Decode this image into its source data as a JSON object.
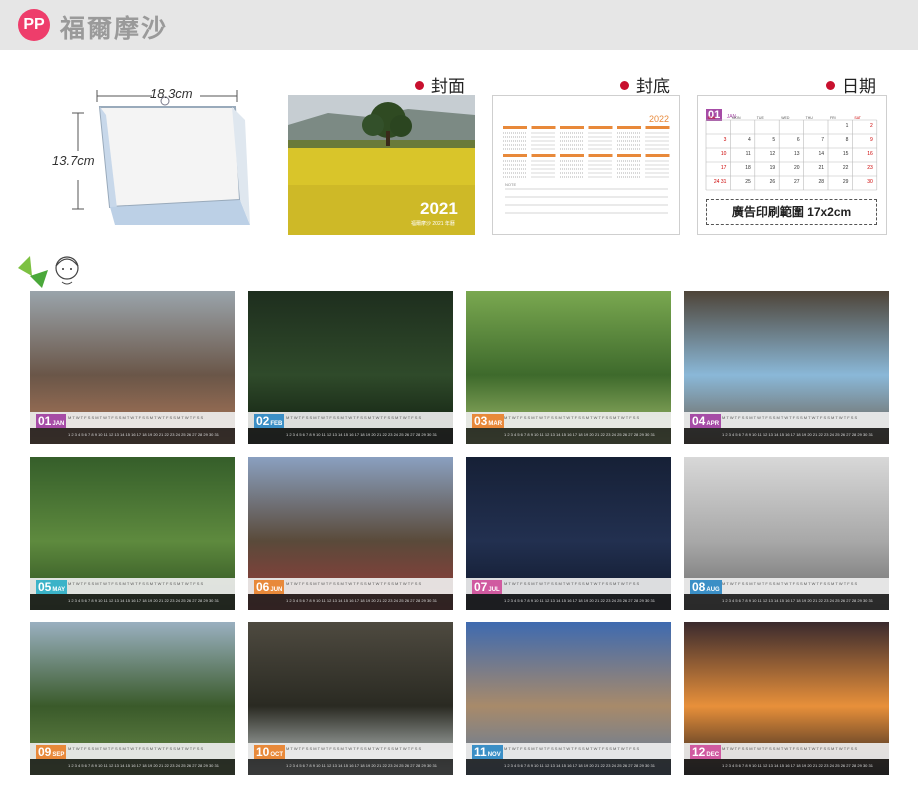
{
  "header": {
    "badge": "PP",
    "brand": "福爾摩沙"
  },
  "dimensions": {
    "width": "18.3cm",
    "height": "13.7cm"
  },
  "cover": {
    "label": "封面",
    "year": "2021",
    "subtitle": "福爾摩沙 2021 年曆"
  },
  "back": {
    "label": "封底",
    "year": "2022",
    "note": "NOTE"
  },
  "date_page": {
    "label": "日期",
    "month_num": "01",
    "month_name": "JAN",
    "print_area": "廣告印刷範圍 17x2cm",
    "weekdays": [
      "SUN",
      "MON",
      "TUE",
      "WED",
      "THU",
      "FRI",
      "SAT"
    ],
    "days": [
      "",
      "",
      "",
      "",
      "",
      "1",
      "2",
      "3",
      "4",
      "5",
      "6",
      "7",
      "8",
      "9",
      "10",
      "11",
      "12",
      "13",
      "14",
      "15",
      "16",
      "17",
      "18",
      "19",
      "20",
      "21",
      "22",
      "23",
      "24 31",
      "25",
      "26",
      "27",
      "28",
      "29",
      "30"
    ]
  },
  "months": [
    {
      "num": "01",
      "name": "JAN",
      "color": "#a64ca6"
    },
    {
      "num": "02",
      "name": "FEB",
      "color": "#3b8fc6"
    },
    {
      "num": "03",
      "name": "MAR",
      "color": "#e8893a"
    },
    {
      "num": "04",
      "name": "APR",
      "color": "#a64ca6"
    },
    {
      "num": "05",
      "name": "MAY",
      "color": "#3bb3c8"
    },
    {
      "num": "06",
      "name": "JUN",
      "color": "#e8893a"
    },
    {
      "num": "07",
      "name": "JUL",
      "color": "#d05aa0"
    },
    {
      "num": "08",
      "name": "AUG",
      "color": "#3b8fc6"
    },
    {
      "num": "09",
      "name": "SEP",
      "color": "#e8893a"
    },
    {
      "num": "10",
      "name": "OCT",
      "color": "#e8893a"
    },
    {
      "num": "11",
      "name": "NOV",
      "color": "#3b8fc6"
    },
    {
      "num": "12",
      "name": "DEC",
      "color": "#d05aa0"
    }
  ],
  "weekday_row": "M T W T F S S M T W T F S S M T W T F S S M T W T F S S M T W T F S S",
  "day_row": "1 2 3 4 5 6 7 8 9 10 11 12 13 14 15 16 17 18 19 20 21 22 23 24 25 26 27 28 29 30 31"
}
